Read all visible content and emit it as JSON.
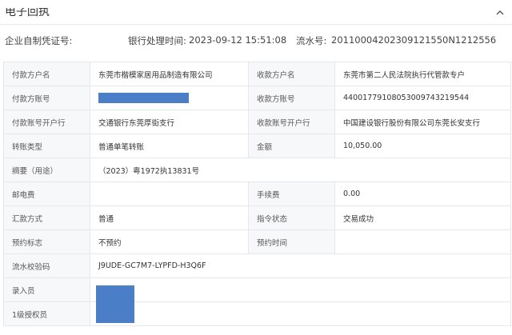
{
  "panel": {
    "title": "电子回执",
    "collapse_icon": "chevron-up-icon"
  },
  "info": {
    "voucher_label": "企业自制凭证号:",
    "time_label": "银行处理时间:",
    "time_value": "2023-09-12 15:51:08",
    "serial_label": "流水号:",
    "serial_value": "20110004202309121550N1212556"
  },
  "rows": [
    {
      "l1": "付款方户名",
      "v1": "东莞市楷模家居用品制造有限公司",
      "l2": "收款方户名",
      "v2": "东莞市第二人民法院执行代管款专户"
    },
    {
      "l1": "付款方账号",
      "v1": "",
      "l2": "收款方账号",
      "v2": "44001779108053009743219544"
    },
    {
      "l1": "付款账号开户行",
      "v1": "交通银行东莞厚街支行",
      "l2": "收款账号开户行",
      "v2": "中国建设银行股份有限公司东莞长安支行"
    },
    {
      "l1": "转账类型",
      "v1": "普通单笔转账",
      "l2": "金额",
      "v2": "10,050.00"
    },
    {
      "l1": "摘要（用途）",
      "v1": "（2023）粤1972执13831号"
    },
    {
      "l1": "邮电费",
      "v1": "",
      "l2": "手续费",
      "v2": "0.00"
    },
    {
      "l1": "汇款方式",
      "v1": "普通",
      "l2": "指令状态",
      "v2": "交易成功"
    },
    {
      "l1": "预约标志",
      "v1": "不预约",
      "l2": "预约时间",
      "v2": ""
    },
    {
      "l1": "流水校验码",
      "v1": "J9UDE-GC7M7-LYPFD-H3Q6F"
    },
    {
      "l1": "录入员",
      "v1": ""
    },
    {
      "l1": "1级授权员",
      "v1": ""
    }
  ],
  "colors": {
    "redaction": "#4a7fc8",
    "label_bg": "#f7f8fa",
    "border": "#e4e7ed"
  }
}
